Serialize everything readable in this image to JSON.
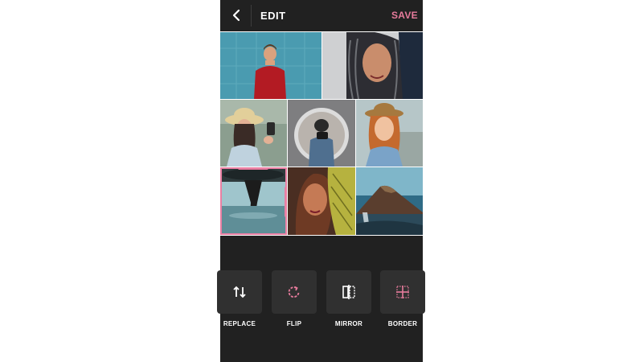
{
  "header": {
    "back_icon": "chevron-left-icon",
    "title": "EDIT",
    "save_label": "SAVE"
  },
  "colors": {
    "background": "#212121",
    "accent": "#e77b9c",
    "tool_box": "#303030",
    "text": "#ffffff"
  },
  "photo_grid": {
    "row1": [
      "man-red-sweater-photo",
      "woman-braids-photo"
    ],
    "row2": [
      "woman-hat-selfie-photo",
      "photographer-mirror-photo",
      "woman-fedora-selfie-photo"
    ],
    "row3": [
      "woman-reflection-photo",
      "woman-palm-leaf-photo",
      "mountain-waterfall-photo"
    ],
    "selected": "woman-reflection-photo"
  },
  "tools": [
    {
      "label": "REPLACE",
      "icon": "swap-vertical-icon"
    },
    {
      "label": "FLIP",
      "icon": "rotate-icon"
    },
    {
      "label": "MIRROR",
      "icon": "mirror-icon"
    },
    {
      "label": "BORDER",
      "icon": "border-grid-icon"
    }
  ]
}
